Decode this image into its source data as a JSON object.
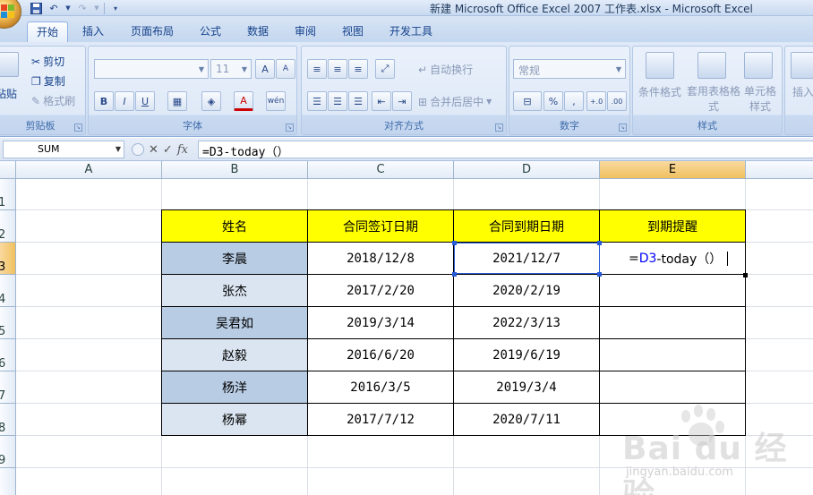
{
  "window": {
    "title": "新建 Microsoft Office Excel 2007 工作表.xlsx - Microsoft Excel"
  },
  "ribbon": {
    "tabs": [
      "开始",
      "插入",
      "页面布局",
      "公式",
      "数据",
      "审阅",
      "视图",
      "开发工具"
    ],
    "active_tab": "开始",
    "clipboard": {
      "label": "剪贴板",
      "paste": "粘贴",
      "cut": "剪切",
      "copy": "复制",
      "format_painter": "格式刷"
    },
    "font": {
      "label": "字体",
      "size": "11",
      "increase": "A",
      "decrease": "A",
      "bold": "B",
      "italic": "I",
      "underline": "U",
      "font_color": "A",
      "phonetic": "wén"
    },
    "alignment": {
      "label": "对齐方式",
      "wrap": "自动换行",
      "merge": "合并后居中"
    },
    "number": {
      "label": "数字",
      "format": "常规",
      "percent": "%",
      "comma": ",",
      "inc_dec": "+.0",
      "dec_dec": ".00"
    },
    "styles": {
      "label": "样式",
      "conditional": "条件格式",
      "table_format": "套用表格格式",
      "cell_styles": "单元格样式"
    },
    "cells": {
      "insert": "插入"
    }
  },
  "formula_bar": {
    "name_box": "SUM",
    "cancel": "✕",
    "enter": "✓",
    "fx": "fx",
    "formula": "=D3-today（）"
  },
  "sheet": {
    "columns": [
      "A",
      "B",
      "C",
      "D",
      "E"
    ],
    "selected_column": "E",
    "rows": [
      "1",
      "2",
      "3",
      "4",
      "5",
      "6",
      "7",
      "8",
      "9"
    ],
    "selected_row": "3",
    "table_headers": [
      "姓名",
      "合同签订日期",
      "合同到期日期",
      "到期提醒"
    ],
    "records": [
      {
        "name": "李晨",
        "signed": "2018/12/8",
        "expires": "2021/12/7"
      },
      {
        "name": "张杰",
        "signed": "2017/2/20",
        "expires": "2020/2/19"
      },
      {
        "name": "吴君如",
        "signed": "2019/3/14",
        "expires": "2022/3/13"
      },
      {
        "name": "赵毅",
        "signed": "2016/6/20",
        "expires": "2019/6/19"
      },
      {
        "name": "杨洋",
        "signed": "2016/3/5",
        "expires": "2019/3/4"
      },
      {
        "name": "杨幂",
        "signed": "2017/7/12",
        "expires": "2020/7/11"
      }
    ],
    "editing_cell": {
      "prefix": "=",
      "ref": "D3",
      "suffix": "-today（）"
    }
  },
  "watermark": {
    "text": "Bai du 经验",
    "url": "jingyan.baidu.com"
  }
}
